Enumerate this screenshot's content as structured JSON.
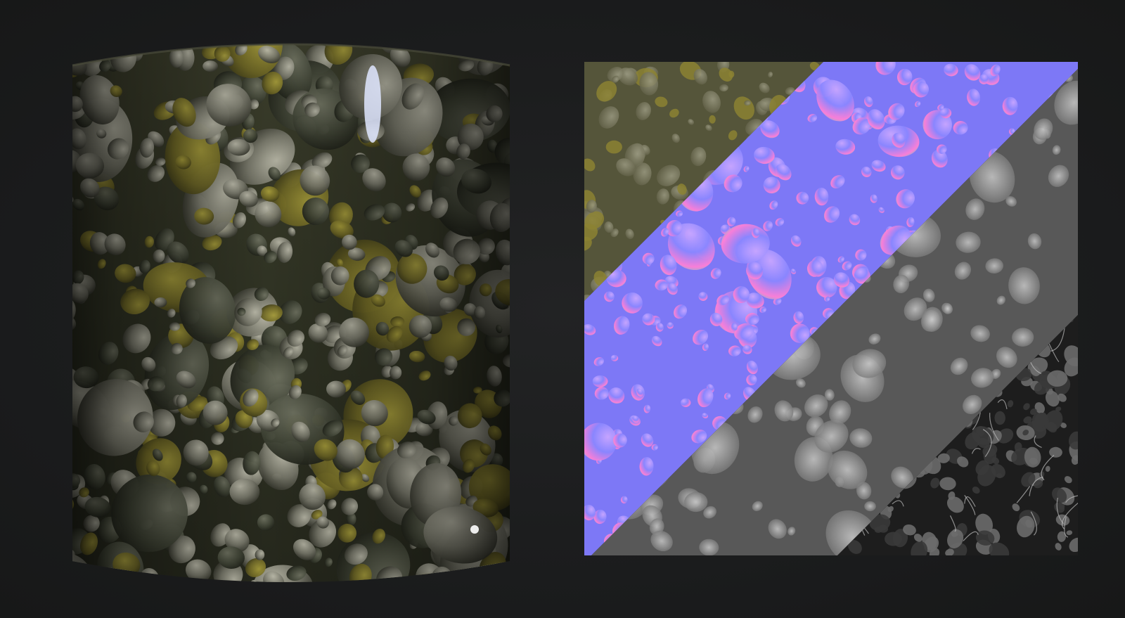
{
  "scene": {
    "background_color": "#1b1c1d",
    "left_object": "material-preview-cylinder",
    "right_object": "texture-map-split-swatch"
  },
  "texture_maps": [
    {
      "name": "base-color",
      "colors": [
        "#5a5a3a",
        "#7a7a48",
        "#8d8a55"
      ]
    },
    {
      "name": "normal",
      "colors": [
        "#8080ff",
        "#7b72f5",
        "#a493ff"
      ]
    },
    {
      "name": "height",
      "colors": [
        "#4a4a4a",
        "#6c6c6c",
        "#b8b8b8"
      ]
    },
    {
      "name": "ambient-occlusion",
      "colors": [
        "#111111",
        "#2b2b2b",
        "#8c8c8c"
      ]
    }
  ],
  "colors": {
    "moss": "#6e6a2a",
    "rock": "#76766a",
    "wet_ground": "#2f3325"
  }
}
